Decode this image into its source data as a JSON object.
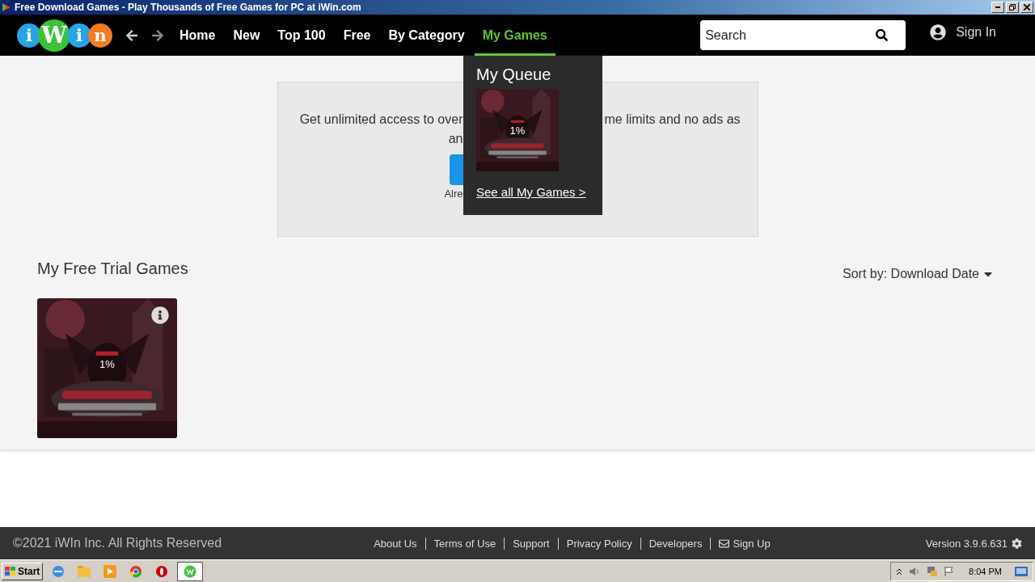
{
  "window": {
    "title": "Free Download Games - Play Thousands of Free Games for PC at iWin.com"
  },
  "nav": {
    "logo": [
      "i",
      "W",
      "i",
      "n"
    ],
    "items": [
      {
        "label": "Home",
        "selected": false
      },
      {
        "label": "New",
        "selected": false
      },
      {
        "label": "Top 100",
        "selected": false
      },
      {
        "label": "Free",
        "selected": false
      },
      {
        "label": "By Category",
        "selected": false
      },
      {
        "label": "My Games",
        "selected": true
      }
    ],
    "search": {
      "placeholder": "Search"
    },
    "sign_in": "Sign In"
  },
  "dropdown": {
    "title": "My Queue",
    "progress": "1%",
    "link": "See all My Games >"
  },
  "banner": {
    "lines": [
      [
        "Get unlimited access to over",
        "me limits and no ads as"
      ],
      [
        "an"
      ]
    ],
    "subscriber": "Alre"
  },
  "section": {
    "title": "My Free Trial Games",
    "sort": "Sort by: Download Date",
    "games": [
      {
        "progress": "1%"
      }
    ]
  },
  "footer": {
    "copyright": "©2021 iWIn Inc. All Rights Reserved",
    "links": [
      "About Us",
      "Terms of Use",
      "Support",
      "Privacy Policy",
      "Developers",
      "Sign Up"
    ],
    "version": "Version 3.9.6.631"
  },
  "taskbar": {
    "start": "Start",
    "clock": "8:04 PM"
  }
}
